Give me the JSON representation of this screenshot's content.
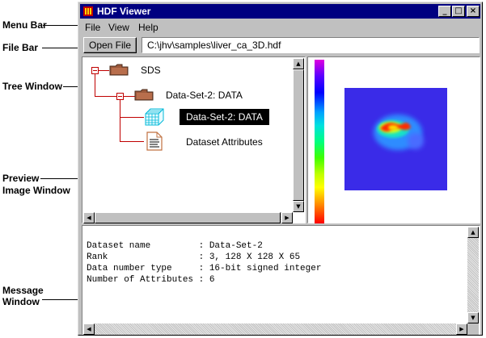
{
  "callouts": {
    "menu_bar": "Menu Bar",
    "file_bar": "File Bar",
    "tree_window": "Tree Window",
    "preview_line1": "Preview",
    "preview_line2": "Image Window",
    "message_line1": "Message",
    "message_line2": "Window"
  },
  "window": {
    "title": "HDF Viewer",
    "minimize_glyph": "_",
    "maximize_glyph": "□",
    "close_glyph": "×"
  },
  "menu": [
    "File",
    "View",
    "Help"
  ],
  "file_bar": {
    "open_label": "Open File",
    "path": "C:\\jhv\\samples\\liver_ca_3D.hdf"
  },
  "tree": {
    "root": "SDS",
    "group": "Data-Set-2: DATA",
    "selected": "Data-Set-2: DATA",
    "attributes": "Dataset Attributes"
  },
  "messages": [
    "Dataset name         : Data-Set-2",
    "Rank                 : 3, 128 X 128 X 65",
    "Data number type     : 16-bit signed integer",
    "Number of Attributes : 6"
  ],
  "colors": {
    "titlebar": "#000080",
    "preview_background": "#3a2be8",
    "window_face": "#c0c0c0"
  }
}
